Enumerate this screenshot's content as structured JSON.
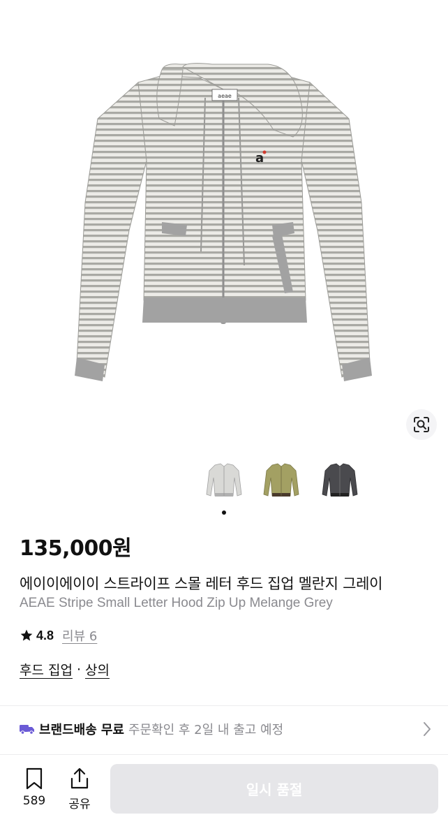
{
  "product": {
    "price": "135,000원",
    "name_ko": "에이이에이이 스트라이프 스몰 레터 후드 집업 멜란지 그레이",
    "name_en": "AEAE Stripe Small Letter Hood Zip Up Melange Grey",
    "rating": "4.8",
    "reviews_label": "리뷰 6",
    "categories": [
      "후드 집업",
      "상의"
    ],
    "category_separator": "·",
    "main_image_label_text": "aeae",
    "chest_logo_text": "a"
  },
  "gallery": {
    "thumbnails": [
      {
        "name": "melange-grey",
        "color": "#d9d9d6",
        "trim": "#b0b0b0"
      },
      {
        "name": "olive",
        "color": "#a3a063",
        "trim": "#4a3a2c"
      },
      {
        "name": "charcoal",
        "color": "#4a4a4e",
        "trim": "#222222"
      }
    ],
    "active_index": 0
  },
  "shipping": {
    "label": "브랜드배송",
    "free": "무료",
    "eta": "주문확인 후 2일 내 출고 예정"
  },
  "bottom_bar": {
    "likes": "589",
    "share_label": "공유",
    "cta_label": "일시 품절"
  },
  "colors": {
    "accent_purple": "#6b5bd6",
    "disabled_button": "#e6e6e9",
    "muted_text": "#8a8a8f"
  }
}
